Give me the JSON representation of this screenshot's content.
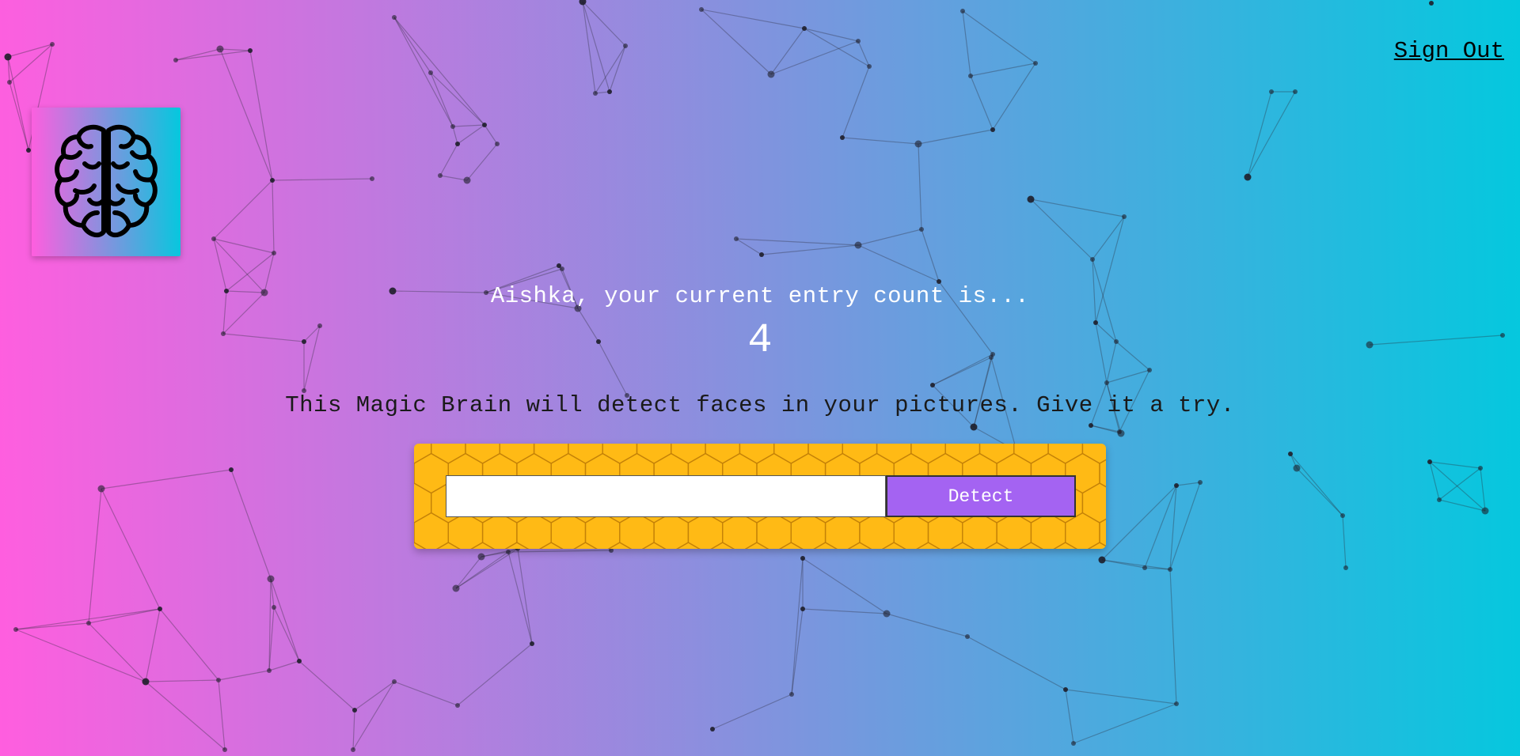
{
  "navigation": {
    "sign_out_label": "Sign Out"
  },
  "logo": {
    "icon": "brain-icon"
  },
  "rank": {
    "message": "Aishka, your current entry count is...",
    "entry_count": "4"
  },
  "description": "This Magic Brain will detect faces in your pictures. Give it a try.",
  "image_link_form": {
    "input_value": "",
    "input_placeholder": "",
    "detect_label": "Detect"
  },
  "colors": {
    "gradient_start": "#ff5edf",
    "gradient_end": "#04c8de",
    "panel_yellow": "#ffba15",
    "button_purple": "#a463f2"
  }
}
